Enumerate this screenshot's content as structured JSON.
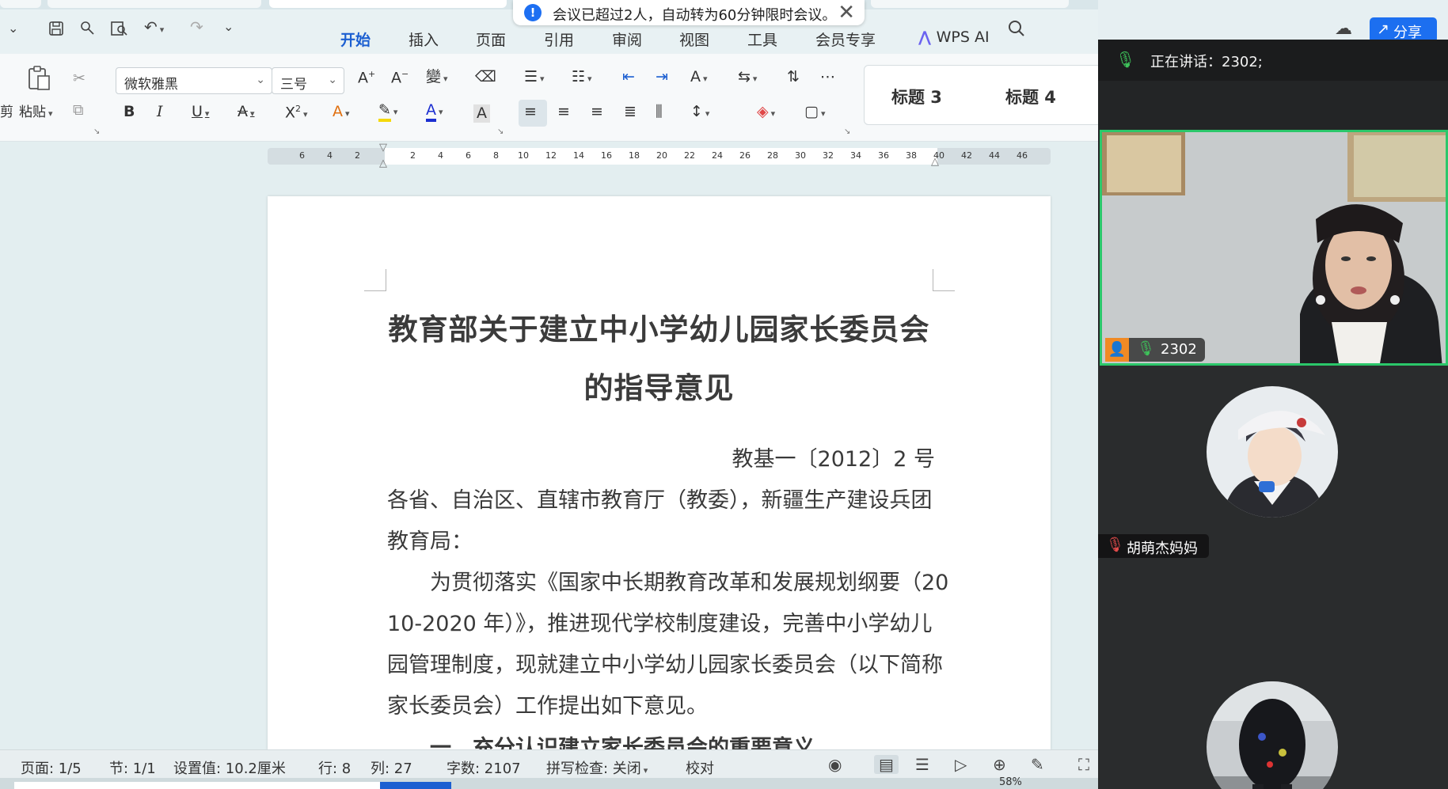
{
  "notification": {
    "text": "会议已超过2人，自动转为60分钟限时会议。",
    "close": "✕"
  },
  "menu": {
    "tabs": [
      "开始",
      "插入",
      "页面",
      "引用",
      "审阅",
      "视图",
      "工具",
      "会员专享"
    ],
    "wps_ai": "WPS AI",
    "share": "分享"
  },
  "ribbon": {
    "paste": "粘贴",
    "cut_partial": "剪",
    "font_name": "微软雅黑",
    "font_size": "三号",
    "styles": [
      "标题 3",
      "标题 4"
    ]
  },
  "ruler": {
    "ticks": [
      "6",
      "4",
      "2",
      "2",
      "4",
      "6",
      "8",
      "10",
      "12",
      "14",
      "16",
      "18",
      "20",
      "22",
      "24",
      "26",
      "28",
      "30",
      "32",
      "34",
      "36",
      "38",
      "40",
      "42",
      "44",
      "46"
    ]
  },
  "document": {
    "title_line1": "教育部关于建立中小学幼儿园家长委员会",
    "title_line2": "的指导意见",
    "doc_number": "教基一〔2012〕2 号",
    "lines": [
      "各省、自治区、直辖市教育厅（教委），新疆生产建设兵团",
      "教育局：",
      "　　为贯彻落实《国家中长期教育改革和发展规划纲要（20",
      "10-2020 年）》，推进现代学校制度建设，完善中小学幼儿",
      "园管理制度，现就建立中小学幼儿园家长委员会（以下简称",
      "家长委员会）工作提出如下意见。",
      "　　一、充分认识建立家长委员会的重要意义"
    ]
  },
  "statusbar": {
    "page": "页面: 1/5",
    "section": "节: 1/1",
    "setting": "设置值: 10.2厘米",
    "row": "行: 8",
    "col": "列: 27",
    "words": "字数: 2107",
    "spell": "拼写检查: 关闭",
    "proof": "校对",
    "zoom_partial": "58%"
  },
  "meeting": {
    "speaking": "正在讲话：2302;",
    "tile1_name": "2302",
    "tile2_name": "胡萌杰妈妈"
  },
  "colors": {
    "accent": "#1c5fd1",
    "share_button": "#1c6ff0",
    "active_speaker_border": "#2bc76a",
    "mic_on": "#3ec25a",
    "mic_muted": "#e24b4b"
  }
}
